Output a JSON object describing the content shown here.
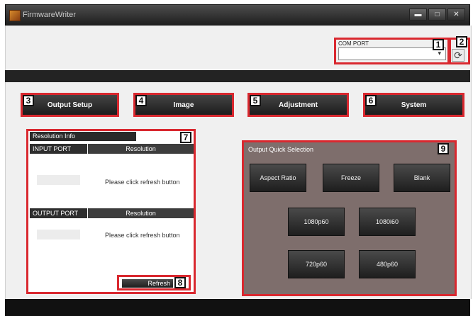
{
  "window": {
    "title": "FirmwareWriter",
    "minimize": "▬",
    "maximize": "□",
    "close": "✕"
  },
  "com_port": {
    "label": "COM PORT",
    "value": "",
    "arrow": "▾",
    "refresh_glyph": "⟳"
  },
  "nav": {
    "output_setup": "Output Setup",
    "image": "Image",
    "adjustment": "Adjustment",
    "system": "System"
  },
  "resolution_info": {
    "title": "Resolution Info",
    "input_header": "INPUT PORT",
    "output_header": "OUTPUT PORT",
    "resolution_header": "Resolution",
    "input_note": "Please click refresh button",
    "output_note": "Please click refresh button",
    "refresh_label": "Refresh"
  },
  "quick_selection": {
    "title": "Output Quick Selection",
    "buttons": [
      "Aspect Ratio",
      "Freeze",
      "Blank",
      "1080p60",
      "1080i60",
      "720p60",
      "480p60"
    ]
  },
  "callouts": [
    "1",
    "2",
    "3",
    "4",
    "5",
    "6",
    "7",
    "8",
    "9"
  ],
  "colors": {
    "callout_border": "#d9282f",
    "panel_background": "#7e6e6c",
    "button_dark": "#2a2a2a"
  }
}
